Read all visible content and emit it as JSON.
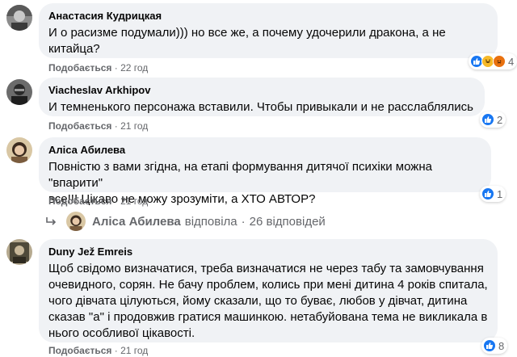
{
  "comments": [
    {
      "author": "Анастасия Кудрицкая",
      "text": "И о расизме подумали))) но все же, а почему удочерили дракона, а не\nкитайца?",
      "like_label": "Подобається",
      "time": "22 год",
      "reaction_count": "4",
      "reactions": [
        "like-icon",
        "haha-icon",
        "angry-icon"
      ]
    },
    {
      "author": "Viacheslav Arkhipov",
      "text": "И темненького персонажа вставили. Чтобы привыкали и не расслаблялись",
      "like_label": "Подобається",
      "time": "21 год",
      "reaction_count": "2",
      "reactions": [
        "like-icon"
      ]
    },
    {
      "author": "Аліса Абилева",
      "text": "Повністю з вами згідна, на етапі формування дитячої психіки можна \"впарити\"\nвсе!!! Цікаво не можу зрозуміти, а ХТО АВТОР?",
      "like_label": "Подобається",
      "time": "21 год",
      "reaction_count": "1",
      "reactions": [
        "like-icon"
      ]
    },
    {
      "author": "Duny Jež Emreis",
      "text": "Щоб свідомо визначатися, треба визначатися не через табу та замовчування\nочевидного, сорян. Не бачу проблем, колись при мені дитина 4 років спитала,\nчого дівчата цілуються, йому сказали, що то буває, любов у дівчат, дитина\nсказав \"а\" і продовжив гратися машинкою. нетабуйована тема не викликала в\nнього особливої цікавості.",
      "like_label": "Подобається",
      "time": "21 год",
      "reaction_count": "8",
      "reactions": [
        "like-icon"
      ]
    }
  ],
  "reply_thread": {
    "author": "Аліса Абилева",
    "action": "відповіла",
    "separator": "·",
    "count": "26 відповідей"
  },
  "separator": "·",
  "colors": {
    "like_blue": "#1877f2",
    "bubble_bg": "#f0f2f5",
    "meta_grey": "#65676b"
  }
}
